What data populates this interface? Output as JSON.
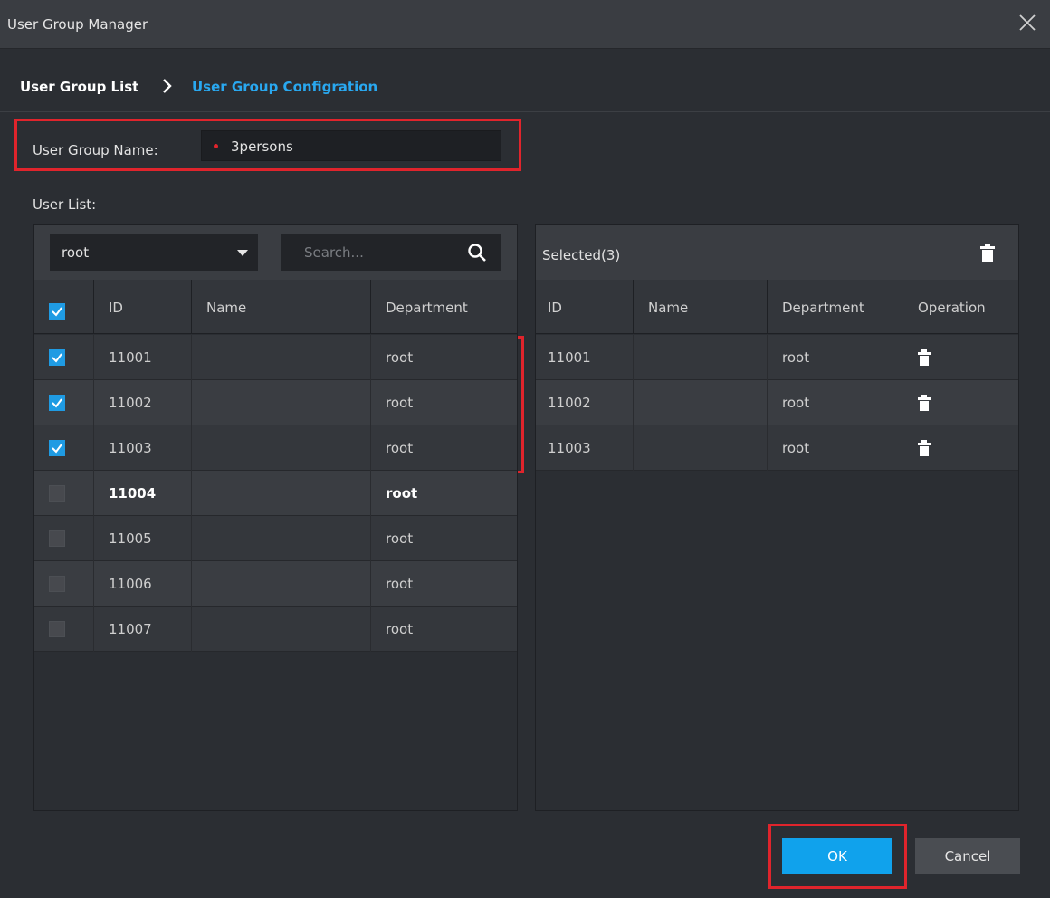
{
  "window": {
    "title": "User Group Manager"
  },
  "breadcrumb": {
    "parent": "User Group List",
    "current": "User Group Configration"
  },
  "form": {
    "name_label": "User Group Name:",
    "name_value": "3persons",
    "user_list_label": "User List:"
  },
  "left": {
    "department": "root",
    "search_placeholder": "Search...",
    "columns": [
      "ID",
      "Name",
      "Department"
    ],
    "rows": [
      {
        "id": "11001",
        "name": "",
        "department": "root",
        "checked": true
      },
      {
        "id": "11002",
        "name": "",
        "department": "root",
        "checked": true
      },
      {
        "id": "11003",
        "name": "",
        "department": "root",
        "checked": true
      },
      {
        "id": "11004",
        "name": "",
        "department": "root",
        "checked": false
      },
      {
        "id": "11005",
        "name": "",
        "department": "root",
        "checked": false
      },
      {
        "id": "11006",
        "name": "",
        "department": "root",
        "checked": false
      },
      {
        "id": "11007",
        "name": "",
        "department": "root",
        "checked": false
      }
    ]
  },
  "right": {
    "title": "Selected(3)",
    "columns": [
      "ID",
      "Name",
      "Department",
      "Operation"
    ],
    "rows": [
      {
        "id": "11001",
        "name": "",
        "department": "root"
      },
      {
        "id": "11002",
        "name": "",
        "department": "root"
      },
      {
        "id": "11003",
        "name": "",
        "department": "root"
      }
    ]
  },
  "buttons": {
    "ok": "OK",
    "cancel": "Cancel"
  },
  "colors": {
    "accent": "#10a2ec",
    "highlight": "#e0242c",
    "link": "#29a8f0"
  }
}
